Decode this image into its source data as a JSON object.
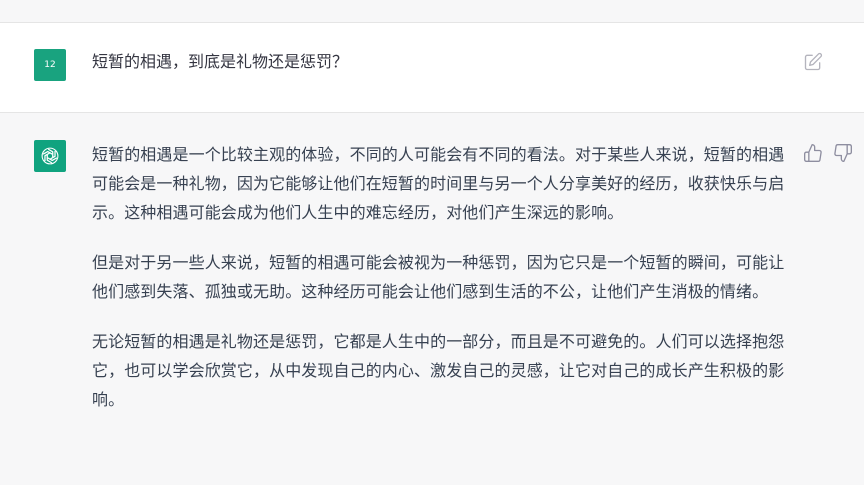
{
  "user_message": {
    "avatar_text": "12",
    "text": "短暂的相遇，到底是礼物还是惩罚？"
  },
  "assistant_message": {
    "paragraphs": [
      "短暂的相遇是一个比较主观的体验，不同的人可能会有不同的看法。对于某些人来说，短暂的相遇可能会是一种礼物，因为它能够让他们在短暂的时间里与另一个人分享美好的经历，收获快乐与启示。这种相遇可能会成为他们人生中的难忘经历，对他们产生深远的影响。",
      "但是对于另一些人来说，短暂的相遇可能会被视为一种惩罚，因为它只是一个短暂的瞬间，可能让他们感到失落、孤独或无助。这种经历可能会让他们感到生活的不公，让他们产生消极的情绪。",
      "无论短暂的相遇是礼物还是惩罚，它都是人生中的一部分，而且是不可避免的。人们可以选择抱怨它，也可以学会欣赏它，从中发现自己的内心、激发自己的灵感，让它对自己的成长产生积极的影响。"
    ]
  },
  "icons": {
    "edit": "edit-icon",
    "thumbs_up": "thumbs-up-icon",
    "thumbs_down": "thumbs-down-icon",
    "assistant_logo": "openai-logo-icon"
  },
  "colors": {
    "user_avatar": "#19a37f",
    "assistant_avatar": "#10a37f",
    "assistant_bg": "#f7f7f8",
    "user_bg": "#ffffff"
  }
}
